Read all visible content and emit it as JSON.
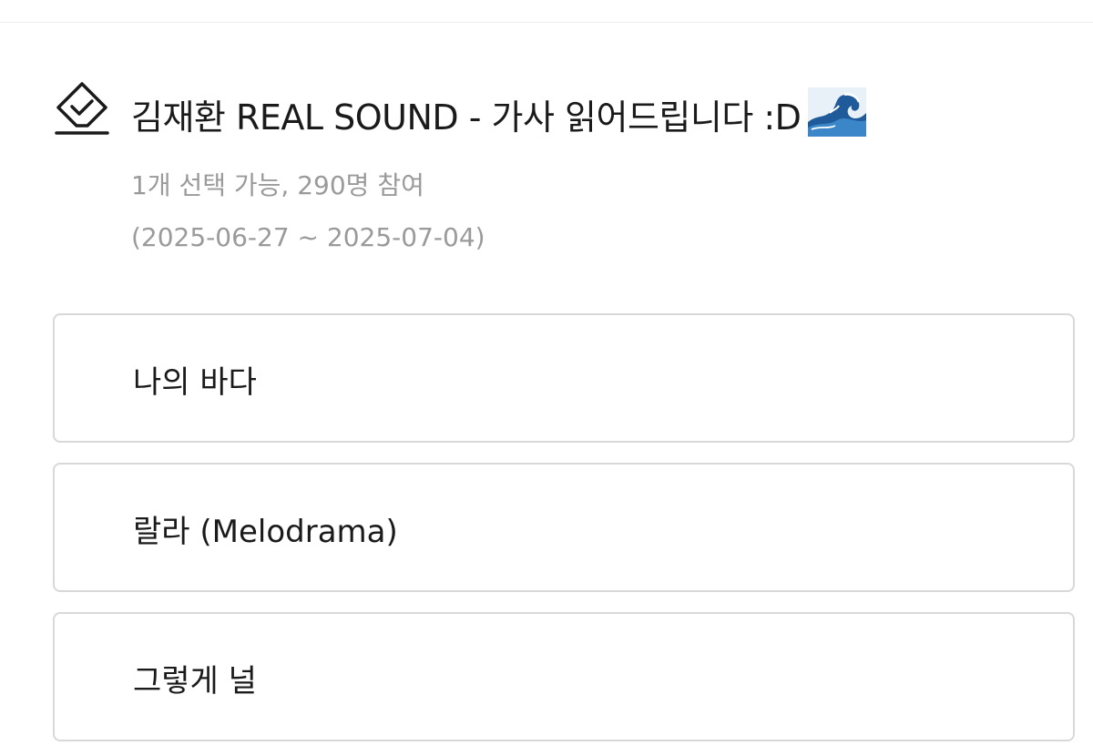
{
  "poll": {
    "title": "김재환 REAL SOUND - 가사 읽어드립니다 :D",
    "title_emoji_icon": "water-wave-icon",
    "poll_icon": "ballot-box-check-icon",
    "meta": "1개 선택 가능, 290명 참여",
    "dates": "(2025-06-27 ~ 2025-07-04)",
    "options": [
      {
        "label": "나의 바다"
      },
      {
        "label": "랄라 (Melodrama)"
      },
      {
        "label": "그렇게 널"
      }
    ]
  },
  "colors": {
    "text": "#1a1a1a",
    "muted": "#9a9a9a",
    "border": "#d8d8d8",
    "background": "#ffffff"
  }
}
